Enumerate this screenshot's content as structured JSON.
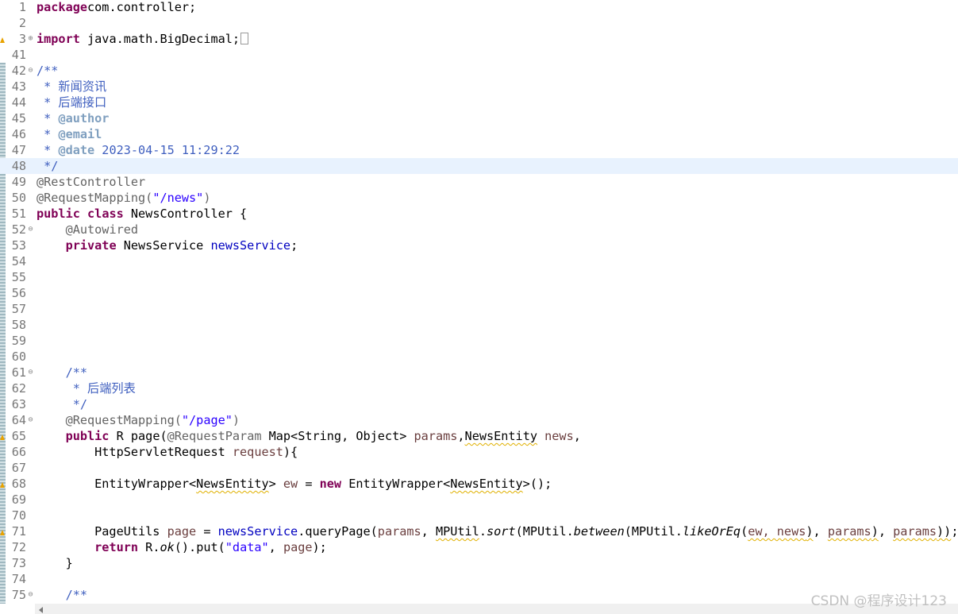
{
  "lines": [
    {
      "n": "1",
      "t": [
        [
          "k",
          "package"
        ],
        [
          "",
          "com.controller;"
        ]
      ]
    },
    {
      "n": "2",
      "t": []
    },
    {
      "n": "3",
      "fold": "+",
      "warn": true,
      "t": [
        [
          "k",
          "import"
        ],
        [
          "",
          " java.math.BigDecimal;"
        ]
      ],
      "box": true
    },
    {
      "n": "41",
      "t": []
    },
    {
      "n": "42",
      "fold": "-",
      "t": [
        [
          "c",
          "/**"
        ]
      ]
    },
    {
      "n": "43",
      "t": [
        [
          "c",
          " * 新闻资讯"
        ]
      ]
    },
    {
      "n": "44",
      "t": [
        [
          "c",
          " * 后端接口"
        ]
      ]
    },
    {
      "n": "45",
      "t": [
        [
          "c",
          " * "
        ],
        [
          "tag",
          "@author"
        ]
      ]
    },
    {
      "n": "46",
      "t": [
        [
          "c",
          " * "
        ],
        [
          "tag",
          "@email"
        ]
      ]
    },
    {
      "n": "47",
      "t": [
        [
          "c",
          " * "
        ],
        [
          "tag",
          "@date"
        ],
        [
          "c",
          " 2023-04-15 11:29:22"
        ]
      ]
    },
    {
      "n": "48",
      "hl": true,
      "t": [
        [
          "c",
          " */"
        ]
      ]
    },
    {
      "n": "49",
      "t": [
        [
          "a",
          "@RestController"
        ]
      ]
    },
    {
      "n": "50",
      "t": [
        [
          "a",
          "@RequestMapping("
        ],
        [
          "s",
          "\"/news\""
        ],
        [
          "a",
          ")"
        ]
      ]
    },
    {
      "n": "51",
      "t": [
        [
          "k",
          "public"
        ],
        [
          "",
          " "
        ],
        [
          "k",
          "class"
        ],
        [
          "",
          " NewsController {"
        ]
      ]
    },
    {
      "n": "52",
      "fold": "-",
      "t": [
        [
          "",
          "    "
        ],
        [
          "a",
          "@Autowired"
        ]
      ]
    },
    {
      "n": "53",
      "t": [
        [
          "",
          "    "
        ],
        [
          "k",
          "private"
        ],
        [
          "",
          " NewsService "
        ],
        [
          "f",
          "newsService"
        ],
        [
          "",
          ";"
        ]
      ]
    },
    {
      "n": "54",
      "t": []
    },
    {
      "n": "55",
      "t": []
    },
    {
      "n": "56",
      "t": []
    },
    {
      "n": "57",
      "t": []
    },
    {
      "n": "58",
      "t": []
    },
    {
      "n": "59",
      "t": []
    },
    {
      "n": "60",
      "t": []
    },
    {
      "n": "61",
      "fold": "-",
      "t": [
        [
          "",
          "    "
        ],
        [
          "c",
          "/**"
        ]
      ]
    },
    {
      "n": "62",
      "t": [
        [
          "",
          "    "
        ],
        [
          "c",
          " * 后端列表"
        ]
      ]
    },
    {
      "n": "63",
      "t": [
        [
          "",
          "    "
        ],
        [
          "c",
          " */"
        ]
      ]
    },
    {
      "n": "64",
      "fold": "-",
      "t": [
        [
          "",
          "    "
        ],
        [
          "a",
          "@RequestMapping("
        ],
        [
          "s",
          "\"/page\""
        ],
        [
          "a",
          ")"
        ]
      ]
    },
    {
      "n": "65",
      "warn": true,
      "t": [
        [
          "",
          "    "
        ],
        [
          "k",
          "public"
        ],
        [
          "",
          " R page("
        ],
        [
          "a",
          "@RequestParam"
        ],
        [
          "",
          " Map<String, Object> "
        ],
        [
          "v",
          "params"
        ],
        [
          "",
          ","
        ],
        [
          "sq",
          "NewsEntity"
        ],
        [
          "",
          " "
        ],
        [
          "v",
          "news"
        ],
        [
          "",
          ","
        ]
      ]
    },
    {
      "n": "66",
      "t": [
        [
          "",
          "        HttpServletRequest "
        ],
        [
          "v",
          "request"
        ],
        [
          "",
          "){"
        ]
      ]
    },
    {
      "n": "67",
      "t": []
    },
    {
      "n": "68",
      "warn": true,
      "t": [
        [
          "",
          "        EntityWrapper<"
        ],
        [
          "sq",
          "NewsEntity"
        ],
        [
          "",
          "> "
        ],
        [
          "v",
          "ew"
        ],
        [
          "",
          " = "
        ],
        [
          "k",
          "new"
        ],
        [
          "",
          " EntityWrapper<"
        ],
        [
          "sq",
          "NewsEntity"
        ],
        [
          "",
          ">();"
        ]
      ]
    },
    {
      "n": "69",
      "t": []
    },
    {
      "n": "70",
      "t": []
    },
    {
      "n": "71",
      "warn": true,
      "t": [
        [
          "",
          "        PageUtils "
        ],
        [
          "v",
          "page"
        ],
        [
          "",
          " = "
        ],
        [
          "f",
          "newsService"
        ],
        [
          "",
          ".queryPage("
        ],
        [
          "v",
          "params"
        ],
        [
          "",
          ", "
        ],
        [
          "sq",
          "MPUtil"
        ],
        [
          "",
          "."
        ],
        [
          "i",
          "sort"
        ],
        [
          "",
          "(MPUtil."
        ],
        [
          "i",
          "between"
        ],
        [
          "",
          "(MPUtil."
        ],
        [
          "i",
          "likeOrEq"
        ],
        [
          "",
          "("
        ],
        [
          "sqv",
          "ew, news"
        ],
        [
          "sq",
          ")"
        ],
        [
          "",
          ", "
        ],
        [
          "sqv",
          "params"
        ],
        [
          "sq",
          ")"
        ],
        [
          "",
          ", "
        ],
        [
          "sqv",
          "params"
        ],
        [
          "sq",
          "))"
        ],
        [
          "",
          ";"
        ]
      ]
    },
    {
      "n": "72",
      "t": [
        [
          "",
          "        "
        ],
        [
          "k",
          "return"
        ],
        [
          "",
          " R."
        ],
        [
          "i",
          "ok"
        ],
        [
          "",
          "().put("
        ],
        [
          "s",
          "\"data\""
        ],
        [
          "",
          ", "
        ],
        [
          "v",
          "page"
        ],
        [
          "",
          ");"
        ]
      ]
    },
    {
      "n": "73",
      "t": [
        [
          "",
          "    }"
        ]
      ]
    },
    {
      "n": "74",
      "t": []
    },
    {
      "n": "75",
      "fold": "-",
      "t": [
        [
          "",
          "    "
        ],
        [
          "c",
          "/**"
        ]
      ]
    }
  ],
  "watermark": "CSDN @程序设计123",
  "colors": {
    "keyword": "#7f0055",
    "string": "#2a00ff",
    "comment": "#3f5fbf",
    "annotation": "#646464",
    "field": "#0000c0",
    "variable": "#6a3e3e",
    "highlight": "#e8f2fe"
  }
}
